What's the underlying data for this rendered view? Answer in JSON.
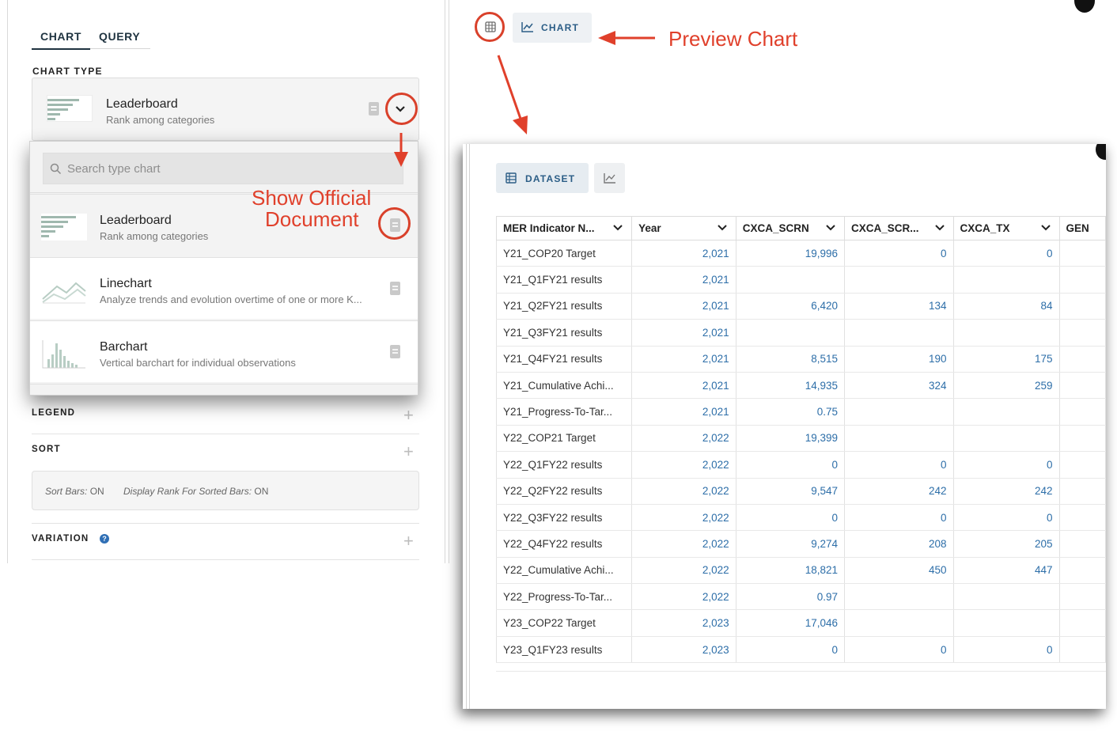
{
  "tabs": {
    "chart": "CHART",
    "query": "QUERY"
  },
  "chart_type_label": "CHART TYPE",
  "selected_type": {
    "title": "Leaderboard",
    "subtitle": "Rank among categories"
  },
  "search": {
    "placeholder": "Search type chart",
    "value": ""
  },
  "chart_types": [
    {
      "title": "Leaderboard",
      "subtitle": "Rank among categories"
    },
    {
      "title": "Linechart",
      "subtitle": "Analyze trends and evolution overtime of one or more K..."
    },
    {
      "title": "Barchart",
      "subtitle": "Vertical barchart for individual observations"
    }
  ],
  "sections": {
    "legend": "LEGEND",
    "sort": "SORT",
    "variation": "VARIATION"
  },
  "sort_settings": {
    "sort_bars_label": "Sort Bars:",
    "sort_bars_value": "ON",
    "rank_label": "Display Rank For Sorted Bars:",
    "rank_value": "ON"
  },
  "annotations": {
    "preview": "Preview Chart",
    "doc_line1": "Show Official",
    "doc_line2": "Document"
  },
  "preview_toolbar": {
    "chart_label": "CHART"
  },
  "preview_window": {
    "dataset_label": "DATASET"
  },
  "table": {
    "columns": [
      "MER Indicator N...",
      "Year",
      "CXCA_SCRN",
      "CXCA_SCR...",
      "CXCA_TX",
      "GEN"
    ],
    "rows": [
      [
        "Y21_COP20 Target",
        "2,021",
        "19,996",
        "0",
        "0"
      ],
      [
        "Y21_Q1FY21 results",
        "2,021",
        "",
        "",
        ""
      ],
      [
        "Y21_Q2FY21 results",
        "2,021",
        "6,420",
        "134",
        "84"
      ],
      [
        "Y21_Q3FY21 results",
        "2,021",
        "",
        "",
        ""
      ],
      [
        "Y21_Q4FY21 results",
        "2,021",
        "8,515",
        "190",
        "175"
      ],
      [
        "Y21_Cumulative Achi...",
        "2,021",
        "14,935",
        "324",
        "259"
      ],
      [
        "Y21_Progress-To-Tar...",
        "2,021",
        "0.75",
        "",
        ""
      ],
      [
        "Y22_COP21 Target",
        "2,022",
        "19,399",
        "",
        ""
      ],
      [
        "Y22_Q1FY22 results",
        "2,022",
        "0",
        "0",
        "0"
      ],
      [
        "Y22_Q2FY22 results",
        "2,022",
        "9,547",
        "242",
        "242"
      ],
      [
        "Y22_Q3FY22 results",
        "2,022",
        "0",
        "0",
        "0"
      ],
      [
        "Y22_Q4FY22 results",
        "2,022",
        "9,274",
        "208",
        "205"
      ],
      [
        "Y22_Cumulative Achi...",
        "2,022",
        "18,821",
        "450",
        "447"
      ],
      [
        "Y22_Progress-To-Tar...",
        "2,022",
        "0.97",
        "",
        ""
      ],
      [
        "Y23_COP22 Target",
        "2,023",
        "17,046",
        "",
        ""
      ],
      [
        "Y23_Q1FY23 results",
        "2,023",
        "0",
        "0",
        "0"
      ]
    ]
  },
  "colors": {
    "annotation": "#e0402b",
    "accent": "#2b5d86",
    "number": "#2d6ea8"
  }
}
